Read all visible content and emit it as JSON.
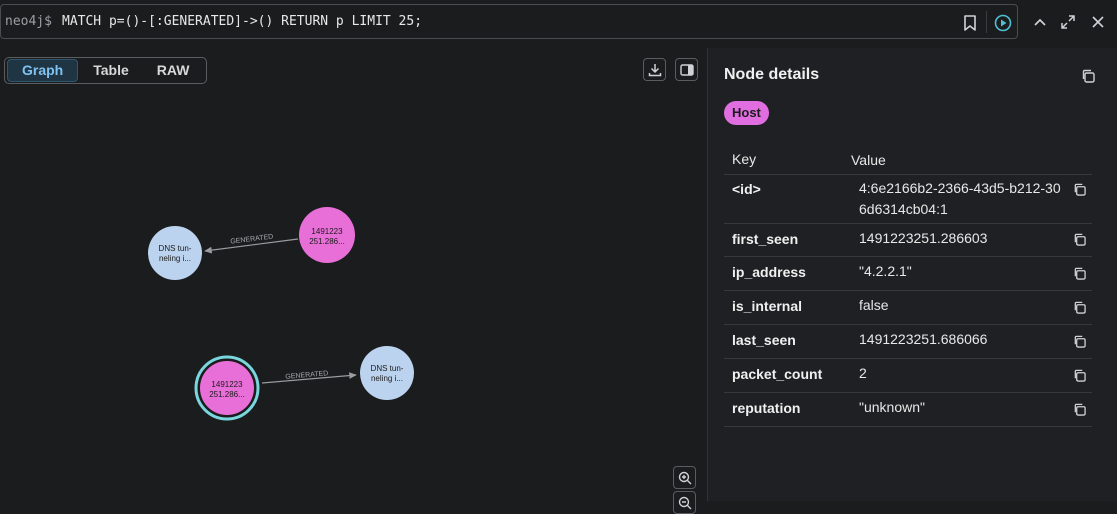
{
  "editor": {
    "prompt": "neo4j$",
    "query": "MATCH p=()-[:GENERATED]->() RETURN p LIMIT 25;"
  },
  "tabs": [
    {
      "label": "Graph",
      "active": true
    },
    {
      "label": "Table",
      "active": false
    },
    {
      "label": "RAW",
      "active": false
    }
  ],
  "graph": {
    "relationship_label": "GENERATED",
    "host_node_caption": [
      "1491223",
      "251.286..."
    ],
    "alert_node_caption": [
      "DNS tun-",
      "neling i..."
    ],
    "colors": {
      "host": "#e86fd8",
      "alert": "#bcd3ef",
      "selected_ring": "#7ad6dd",
      "edge": "#9a9ca0"
    }
  },
  "panel": {
    "title": "Node details",
    "label": "Host",
    "label_color": "#e06ee0",
    "columns": {
      "key": "Key",
      "value": "Value"
    },
    "properties": [
      {
        "key": "<id>",
        "value": "4:6e2166b2-2366-43d5-b212-306d6314cb04:1"
      },
      {
        "key": "first_seen",
        "value": "1491223251.286603"
      },
      {
        "key": "ip_address",
        "value": "\"4.2.2.1\""
      },
      {
        "key": "is_internal",
        "value": "false"
      },
      {
        "key": "last_seen",
        "value": "1491223251.686066"
      },
      {
        "key": "packet_count",
        "value": "2"
      },
      {
        "key": "reputation",
        "value": "\"unknown\""
      }
    ]
  }
}
